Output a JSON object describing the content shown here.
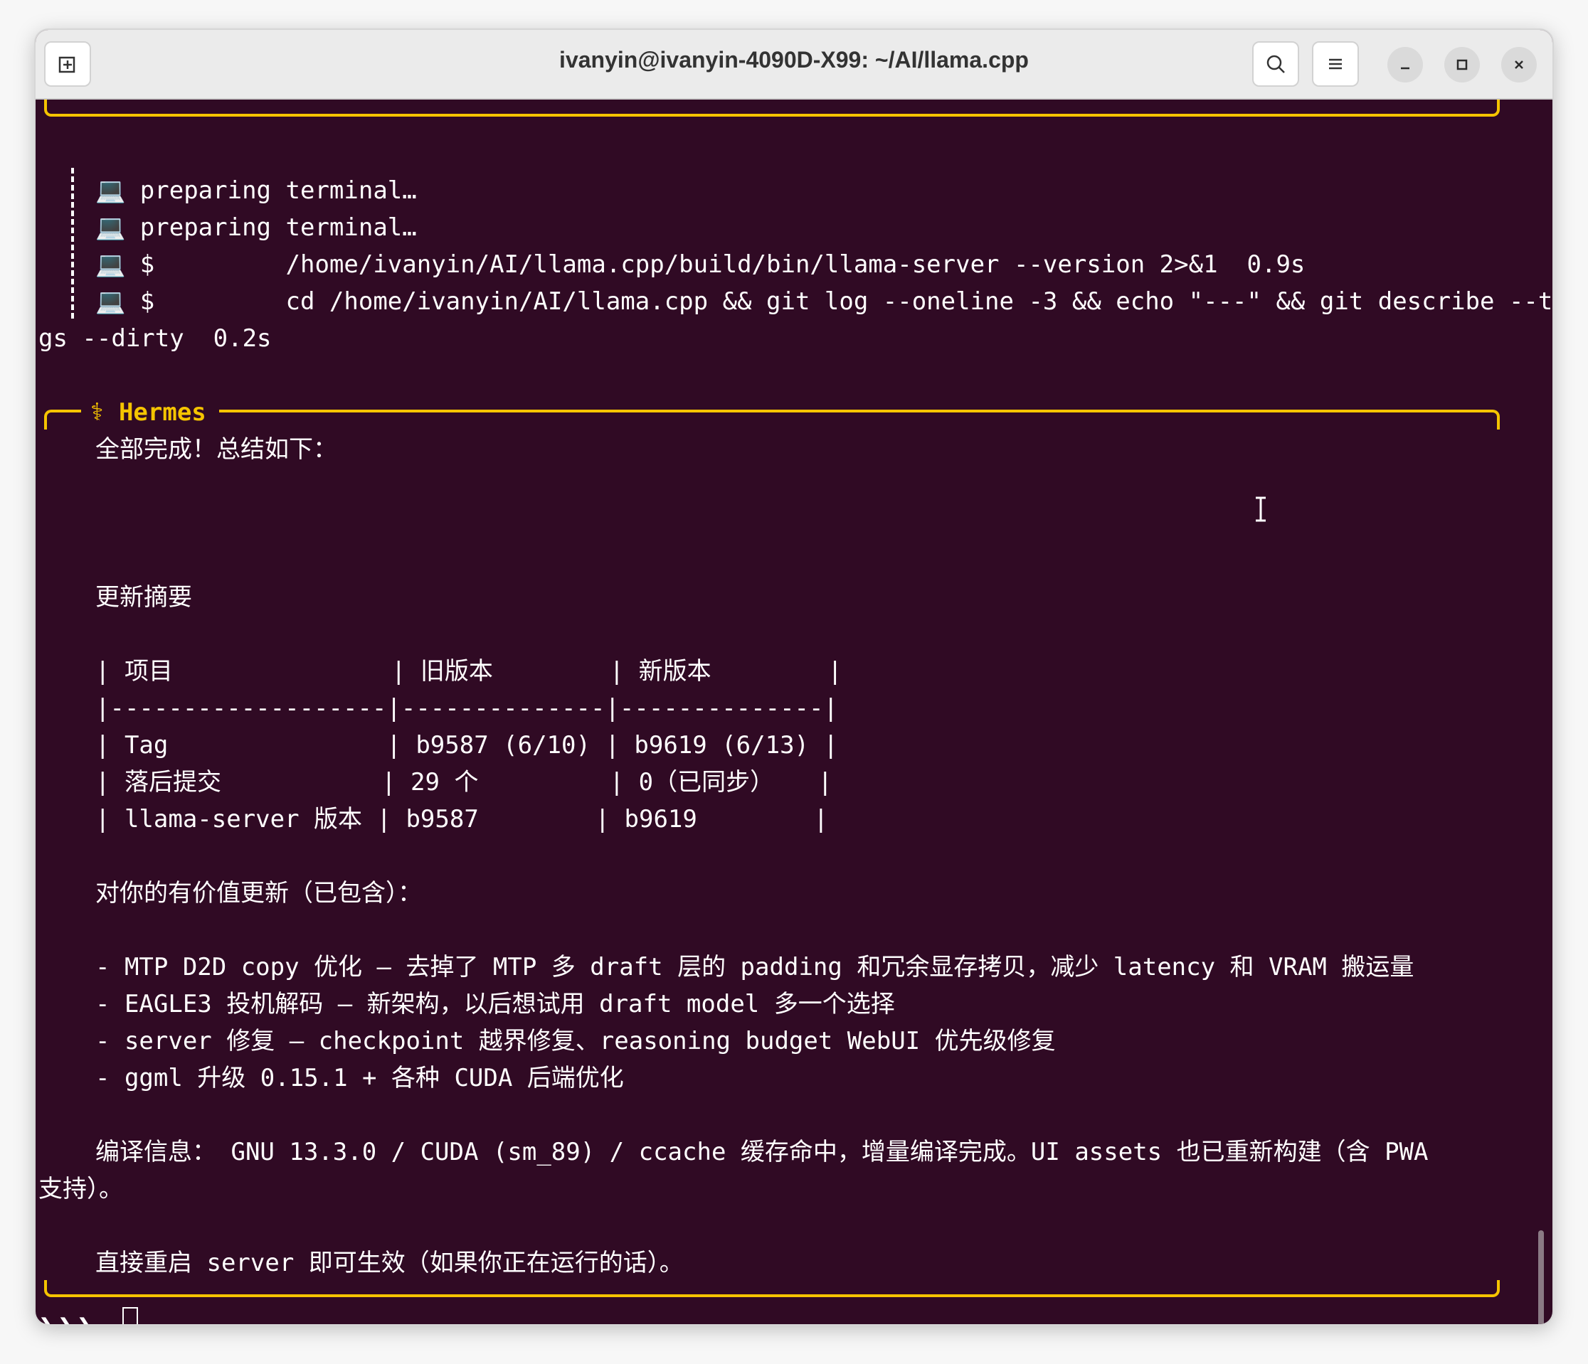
{
  "window": {
    "title": "ivanyin@ivanyin-4090D-X99: ~/AI/llama.cpp"
  },
  "titlebar": {
    "new_tab_icon": "new-tab-icon",
    "search_icon": "search-icon",
    "menu_icon": "hamburger-menu-icon",
    "minimize_icon": "minimize-icon",
    "maximize_icon": "maximize-icon",
    "close_icon": "close-icon"
  },
  "terminal": {
    "activity": [
      "💻 preparing terminal…",
      "💻 preparing terminal…",
      "💻 $         /home/ivanyin/AI/llama.cpp/build/bin/llama-server --version 2>&1  0.9s",
      "💻 $         cd /home/ivanyin/AI/llama.cpp && git log --oneline -3 && echo \"---\" && git describe --ta"
    ],
    "activity_wrap": "gs --dirty  0.2s",
    "hermes_label": "⚕ Hermes",
    "intro": "全部完成！总结如下：",
    "summary_heading": "更新摘要",
    "table_rows": [
      "| 项目               | 旧版本        | 新版本        |",
      "|-------------------|--------------|--------------|",
      "| Tag               | b9587 (6/10) | b9619 (6/13) |",
      "| 落后提交           | 29 个         | 0（已同步）   |",
      "| llama-server 版本 | b9587        | b9619        |"
    ],
    "updates_heading": "对你的有价值更新（已包含）：",
    "updates": [
      "- MTP D2D copy 优化 — 去掉了 MTP 多 draft 层的 padding 和冗余显存拷贝，减少 latency 和 VRAM 搬运量",
      "- EAGLE3 投机解码 — 新架构，以后想试用 draft model 多一个选择",
      "- server 修复 — checkpoint 越界修复、reasoning budget WebUI 优先级修复",
      "- ggml 升级 0.15.1 + 各种 CUDA 后端优化"
    ],
    "build_info": "编译信息： GNU 13.3.0 / CUDA (sm_89) / ccache 缓存命中，增量编译完成。UI assets 也已重新构建（含 PWA",
    "build_info_wrap": "支持）。",
    "restart_note": "直接重启 server 即可生效（如果你正在运行的话）。",
    "prompt": "❯❯❯"
  },
  "colors": {
    "background": "#300a24",
    "accent": "#f5c400",
    "text": "#ffffff"
  }
}
